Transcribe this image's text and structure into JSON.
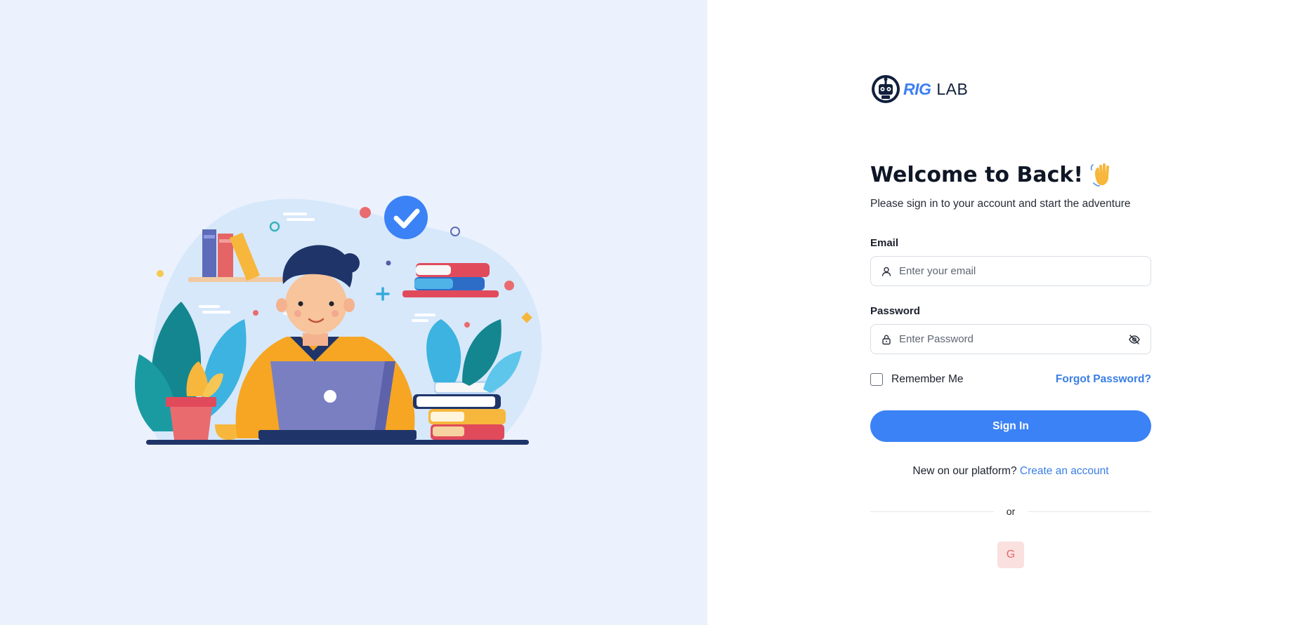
{
  "brand": {
    "name_part1": "RIG",
    "name_part2": "LAB",
    "logo_icon": "robot-head-icon",
    "accent_color": "#3d7ff4"
  },
  "welcome": {
    "title": "Welcome to Back!",
    "emoji_icon": "waving-hand-icon",
    "subtitle": "Please sign in to your account and start the adventure"
  },
  "form": {
    "email": {
      "label": "Email",
      "placeholder": "Enter your email",
      "value": "",
      "icon": "user-icon"
    },
    "password": {
      "label": "Password",
      "placeholder": "Enter Password",
      "value": "",
      "icon": "lock-icon",
      "toggle_icon": "eye-off-icon"
    },
    "remember_me": {
      "label": "Remember Me",
      "checked": false
    },
    "forgot_password": "Forgot Password?",
    "submit_label": "Sign In"
  },
  "signup": {
    "prompt": "New on our platform?",
    "link": "Create an account"
  },
  "divider": "or",
  "social": {
    "google_label": "G",
    "google_icon": "google-icon"
  },
  "colors": {
    "primary": "#3b82f6",
    "left_background": "#ebf2fd",
    "google_button_bg": "#fbe0e0"
  }
}
